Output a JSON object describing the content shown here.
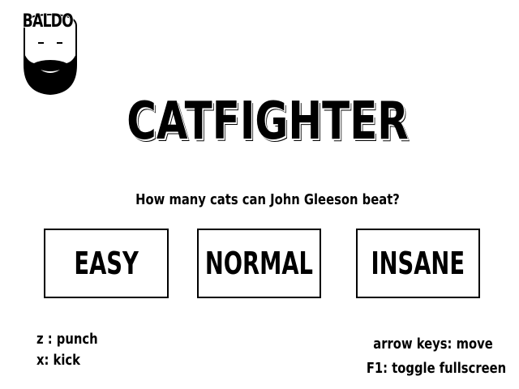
{
  "logo": {
    "text": "BALDO",
    "icon": "bald-bearded-face-icon"
  },
  "title": "CATFIGHTER",
  "prompt": "How many cats can John Gleeson beat?",
  "difficulty": {
    "easy": "EASY",
    "normal": "NORMAL",
    "insane": "INSANE"
  },
  "controls": {
    "punch": "z : punch",
    "kick": "x: kick",
    "move": "arrow keys: move",
    "fullscreen": "F1: toggle fullscreen"
  },
  "colors": {
    "background": "#ffffff",
    "foreground": "#000000"
  }
}
